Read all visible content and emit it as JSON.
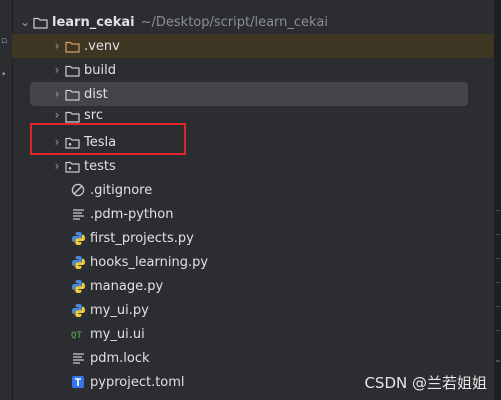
{
  "project": {
    "name": "learn_cekai",
    "path": "~/Desktop/script/learn_cekai"
  },
  "items": [
    {
      "label": ".venv",
      "type": "folder",
      "icon": "folder-icon",
      "color": "#d7a16c"
    },
    {
      "label": "build",
      "type": "folder",
      "icon": "folder-icon"
    },
    {
      "label": "dist",
      "type": "folder",
      "icon": "folder-icon"
    },
    {
      "label": "src",
      "type": "folder",
      "icon": "folder-icon"
    },
    {
      "label": "Tesla",
      "type": "package",
      "icon": "package-folder-icon"
    },
    {
      "label": "tests",
      "type": "package",
      "icon": "package-folder-icon"
    },
    {
      "label": ".gitignore",
      "type": "file",
      "icon": "ignore-file-icon"
    },
    {
      "label": ".pdm-python",
      "type": "file",
      "icon": "text-file-icon"
    },
    {
      "label": "first_projects.py",
      "type": "file",
      "icon": "python-file-icon"
    },
    {
      "label": "hooks_learning.py",
      "type": "file",
      "icon": "python-file-icon"
    },
    {
      "label": "manage.py",
      "type": "file",
      "icon": "python-file-icon"
    },
    {
      "label": "my_ui.py",
      "type": "file",
      "icon": "python-file-icon"
    },
    {
      "label": "my_ui.ui",
      "type": "file",
      "icon": "qt-ui-file-icon"
    },
    {
      "label": "pdm.lock",
      "type": "file",
      "icon": "text-file-icon"
    },
    {
      "label": "pyproject.toml",
      "type": "file",
      "icon": "toml-file-icon"
    }
  ],
  "watermark": "CSDN @兰若姐姐",
  "colors": {
    "highlight_row": "#3f3523",
    "selected_row": "#43454a",
    "annotation_box": "#e0242c"
  }
}
